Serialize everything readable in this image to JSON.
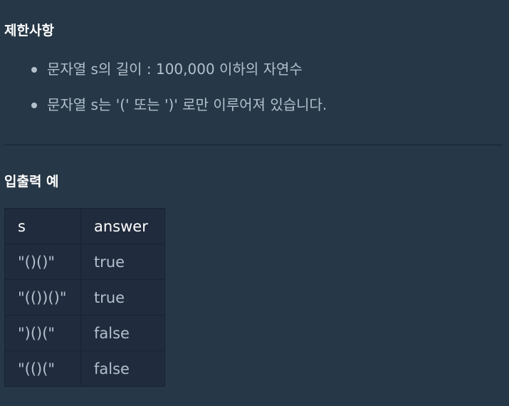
{
  "sections": {
    "constraints_title": "제한사항",
    "examples_title": "입출력 예"
  },
  "constraints": [
    "문자열 s의 길이 : 100,000 이하의 자연수",
    "문자열 s는 '(' 또는 ')' 로만 이루어져 있습니다."
  ],
  "table": {
    "headers": [
      "s",
      "answer"
    ],
    "rows": [
      [
        "\"()()\"",
        "true"
      ],
      [
        "\"(())()\"",
        "true"
      ],
      [
        "\")()(\"",
        "false"
      ],
      [
        "\"(()(\"",
        "false"
      ]
    ]
  }
}
